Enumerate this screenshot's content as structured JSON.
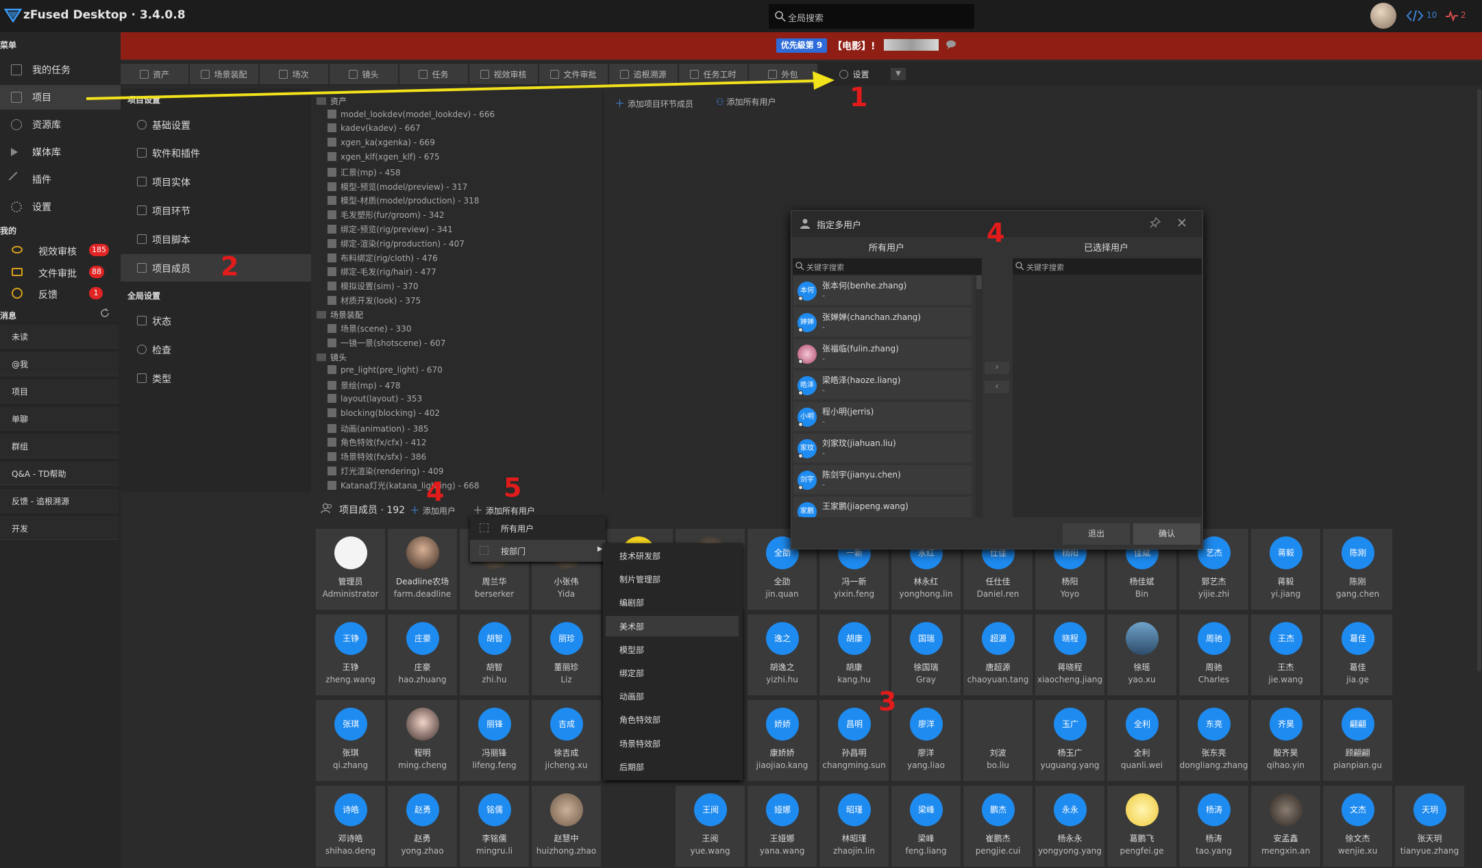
{
  "app": {
    "title": "zFused Desktop · 3.4.0.8"
  },
  "topbar": {
    "search_placeholder": "全局搜索",
    "code_count": "10",
    "bell_count": "2"
  },
  "banner": {
    "priority": "优先級第 9",
    "text": "【电影】!"
  },
  "sidebar": {
    "menu_header": "菜单",
    "items": [
      {
        "label": "我的任务",
        "icon": "task-icon"
      },
      {
        "label": "项目",
        "icon": "project-icon"
      },
      {
        "label": "资源库",
        "icon": "library-icon"
      },
      {
        "label": "媒体库",
        "icon": "media-icon"
      },
      {
        "label": "插件",
        "icon": "plugin-icon"
      },
      {
        "label": "设置",
        "icon": "gear-icon"
      }
    ],
    "mine_header": "我的",
    "mine": [
      {
        "label": "视效审核",
        "badge": "185",
        "icon": "eye-icon"
      },
      {
        "label": "文件审批",
        "badge": "88",
        "icon": "folder-icon"
      },
      {
        "label": "反馈",
        "badge": "1",
        "icon": "info-icon"
      }
    ],
    "msg_header": "消息",
    "messages": [
      "未读",
      "@我",
      "项目",
      "单聊",
      "群组",
      "Q&A - TD帮助",
      "反馈 - 追根溯源",
      "开发"
    ]
  },
  "tabs": [
    "资产",
    "场景装配",
    "场次",
    "镜头",
    "任务",
    "视效审核",
    "文件审批",
    "追根溯源",
    "任务工时",
    "外包",
    "设置"
  ],
  "settings_nav": {
    "project_header": "项目设置",
    "project_items": [
      "基础设置",
      "软件和插件",
      "项目实体",
      "项目环节",
      "项目脚本",
      "项目成员"
    ],
    "global_header": "全局设置",
    "global_items": [
      "状态",
      "检查",
      "类型"
    ]
  },
  "tree": {
    "groups": [
      {
        "label": "资产",
        "items": [
          "model_lookdev(model_lookdev) - 666",
          "kadev(kadev) - 667",
          "xgen_ka(xgenka) - 669",
          "xgen_klf(xgen_klf) - 675",
          "汇景(mp) - 458",
          "模型-预览(model/preview) - 317",
          "模型-材质(model/production) - 318",
          "毛发塑形(fur/groom) - 342",
          "绑定-预览(rig/preview) - 341",
          "绑定-渲染(rig/production) - 407",
          "布料绑定(rig/cloth) - 476",
          "绑定-毛发(rig/hair) - 477",
          "模拟设置(sim) - 370",
          "材质开发(look) - 375"
        ]
      },
      {
        "label": "场景装配",
        "items": [
          "场景(scene) - 330",
          "一镜一景(shotscene) - 607"
        ]
      },
      {
        "label": "镜头",
        "items": [
          "pre_light(pre_light) - 670",
          "景绘(mp) - 478",
          "layout(layout) - 353",
          "blocking(blocking) - 402",
          "动画(animation) - 385",
          "角色特效(fx/cfx) - 412",
          "场景特效(fx/sfx) - 386",
          "灯光渲染(rendering) - 409",
          "Katana灯光(katana_lighting) - 668"
        ]
      }
    ]
  },
  "right_panel": {
    "add_member": "添加项目环节成员",
    "add_all": "添加所有用户"
  },
  "members": {
    "title": "项目成员 · 192",
    "add_user": "添加用户",
    "add_all_users": "添加所有用户",
    "cards": [
      [
        {
          "cn": "管理员",
          "en": "Administrator",
          "av": "",
          "img": "admin"
        },
        {
          "cn": "Deadline农场",
          "en": "farm.deadline",
          "av": "",
          "img": "glasses"
        },
        {
          "cn": "周兰华",
          "en": "berserker",
          "av": "",
          "img": "photo"
        },
        {
          "cn": "小张伟",
          "en": "Yida",
          "av": "",
          "img": "photo"
        },
        {
          "cn": "",
          "en": "",
          "av": "",
          "img": "yellow"
        },
        {
          "cn": "",
          "en": "",
          "av": "",
          "img": "photo"
        },
        {
          "cn": "全劭",
          "en": "jin.quan",
          "av": "全劭"
        },
        {
          "cn": "冯一新",
          "en": "yixin.feng",
          "av": "一新"
        },
        {
          "cn": "林永红",
          "en": "yonghong.lin",
          "av": "永红"
        },
        {
          "cn": "任仕佳",
          "en": "Daniel.ren",
          "av": "仕佳"
        },
        {
          "cn": "杨阳",
          "en": "Yoyo",
          "av": "杨阳"
        },
        {
          "cn": "杨佳斌",
          "en": "Bin",
          "av": "佳斌"
        },
        {
          "cn": "郅艺杰",
          "en": "yijie.zhi",
          "av": "艺杰"
        },
        {
          "cn": "蒋毅",
          "en": "yi.jiang",
          "av": "蒋毅"
        },
        {
          "cn": "陈刚",
          "en": "gang.chen",
          "av": "陈刚"
        }
      ],
      [
        {
          "cn": "王铮",
          "en": "zheng.wang",
          "av": "王铮"
        },
        {
          "cn": "庄豪",
          "en": "hao.zhuang",
          "av": "庄豪"
        },
        {
          "cn": "胡智",
          "en": "zhi.hu",
          "av": "胡智"
        },
        {
          "cn": "董丽珍",
          "en": "Liz",
          "av": "丽珍"
        },
        {
          "cn": "",
          "en": "",
          "av": ""
        },
        {
          "cn": "",
          "en": "",
          "av": ""
        },
        {
          "cn": "胡逸之",
          "en": "yizhi.hu",
          "av": "逸之"
        },
        {
          "cn": "胡康",
          "en": "kang.hu",
          "av": "胡康"
        },
        {
          "cn": "徐国瑞",
          "en": "Gray",
          "av": "国瑞"
        },
        {
          "cn": "唐超源",
          "en": "chaoyuan.tang",
          "av": "超源"
        },
        {
          "cn": "蒋晓程",
          "en": "xiaocheng.jiang",
          "av": "晓程"
        },
        {
          "cn": "徐瑶",
          "en": "yao.xu",
          "av": "",
          "img": "scene"
        },
        {
          "cn": "周驰",
          "en": "Charles",
          "av": "周驰"
        },
        {
          "cn": "王杰",
          "en": "jie.wang",
          "av": "王杰"
        },
        {
          "cn": "葛佳",
          "en": "jia.ge",
          "av": "葛佳"
        }
      ],
      [
        {
          "cn": "张琪",
          "en": "qi.zhang",
          "av": "张琪"
        },
        {
          "cn": "程明",
          "en": "ming.cheng",
          "av": "",
          "img": "face"
        },
        {
          "cn": "冯丽锋",
          "en": "lifeng.feng",
          "av": "丽锋"
        },
        {
          "cn": "徐吉成",
          "en": "jicheng.xu",
          "av": "吉成"
        },
        {
          "cn": "",
          "en": "",
          "av": ""
        },
        {
          "cn": "",
          "en": "",
          "av": ""
        },
        {
          "cn": "康娇娇",
          "en": "jiaojiao.kang",
          "av": "娇娇"
        },
        {
          "cn": "孙昌明",
          "en": "changming.sun",
          "av": "昌明"
        },
        {
          "cn": "廖洋",
          "en": "yang.liao",
          "av": "廖洋"
        },
        {
          "cn": "刘波",
          "en": "bo.liu",
          "av": "",
          "img": "duck"
        },
        {
          "cn": "杨玉广",
          "en": "yuguang.yang",
          "av": "玉广"
        },
        {
          "cn": "全利",
          "en": "quanli.wei",
          "av": "全利"
        },
        {
          "cn": "张东亮",
          "en": "dongliang.zhang",
          "av": "东亮"
        },
        {
          "cn": "殷齐昊",
          "en": "qihao.yin",
          "av": "齐昊"
        },
        {
          "cn": "顾翩翩",
          "en": "pianpian.gu",
          "av": "翩翩"
        }
      ],
      [
        {
          "cn": "邓诗皓",
          "en": "shihao.deng",
          "av": "诗皓"
        },
        {
          "cn": "赵勇",
          "en": "yong.zhao",
          "av": "赵勇"
        },
        {
          "cn": "李铭儒",
          "en": "mingru.li",
          "av": "铭儒"
        },
        {
          "cn": "赵慧中",
          "en": "huizhong.zhao",
          "av": "",
          "img": "cat"
        },
        {
          "cn": "",
          "en": "",
          "av": ""
        },
        {
          "cn": "王阅",
          "en": "yue.wang",
          "av": "王阅"
        },
        {
          "cn": "王娅娜",
          "en": "yana.wang",
          "av": "娅娜"
        },
        {
          "cn": "林昭瑾",
          "en": "zhaojin.lin",
          "av": "昭瑾"
        },
        {
          "cn": "梁峰",
          "en": "feng.liang",
          "av": "梁峰"
        },
        {
          "cn": "崔鹏杰",
          "en": "pengjie.cui",
          "av": "鹏杰"
        },
        {
          "cn": "杨永永",
          "en": "yongyong.yang",
          "av": "永永"
        },
        {
          "cn": "葛鹏飞",
          "en": "pengfei.ge",
          "av": "",
          "img": "chick"
        },
        {
          "cn": "杨涛",
          "en": "tao.yang",
          "av": "杨涛"
        },
        {
          "cn": "安孟鑫",
          "en": "mengxin.an",
          "av": "",
          "img": "piano"
        },
        {
          "cn": "徐文杰",
          "en": "wenjie.xu",
          "av": "文杰"
        },
        {
          "cn": "张天玥",
          "en": "tianyue.zhang",
          "av": "天玥"
        }
      ]
    ]
  },
  "dropdown": {
    "items": [
      "所有用户",
      "按部门"
    ]
  },
  "departments": [
    "技术研发部",
    "制片管理部",
    "编剧部",
    "美术部",
    "模型部",
    "绑定部",
    "动画部",
    "角色特效部",
    "场景特效部",
    "后期部"
  ],
  "dialog": {
    "title": "指定多用户",
    "all_users": "所有用户",
    "selected_users": "已选择用户",
    "search_placeholder": "关键字搜索",
    "users": [
      {
        "name": "张本何(benhe.zhang)",
        "sub": "-",
        "av": "本何"
      },
      {
        "name": "张婵婵(chanchan.zhang)",
        "sub": "-",
        "av": "婵婵"
      },
      {
        "name": "张福临(fulin.zhang)",
        "sub": "-",
        "av": "",
        "img": "flower"
      },
      {
        "name": "梁皓泽(haoze.liang)",
        "sub": "-",
        "av": "皓泽"
      },
      {
        "name": "程小明(jerris)",
        "sub": "-",
        "av": "小明"
      },
      {
        "name": "刘家玟(jiahuan.liu)",
        "sub": "-",
        "av": "家玟"
      },
      {
        "name": "陈剑宇(jianyu.chen)",
        "sub": "-",
        "av": "剑宇"
      },
      {
        "name": "王家鹏(jiapeng.wang)",
        "sub": "",
        "av": "家鹏"
      }
    ],
    "exit": "退出",
    "confirm": "确认"
  },
  "annotations": [
    "1",
    "2",
    "3",
    "4",
    "4",
    "5"
  ],
  "colors": {
    "accent": "#1e8bf0",
    "banner": "#8f1f14",
    "annotation": "#e21b1b",
    "arrow": "#f2e21b"
  }
}
